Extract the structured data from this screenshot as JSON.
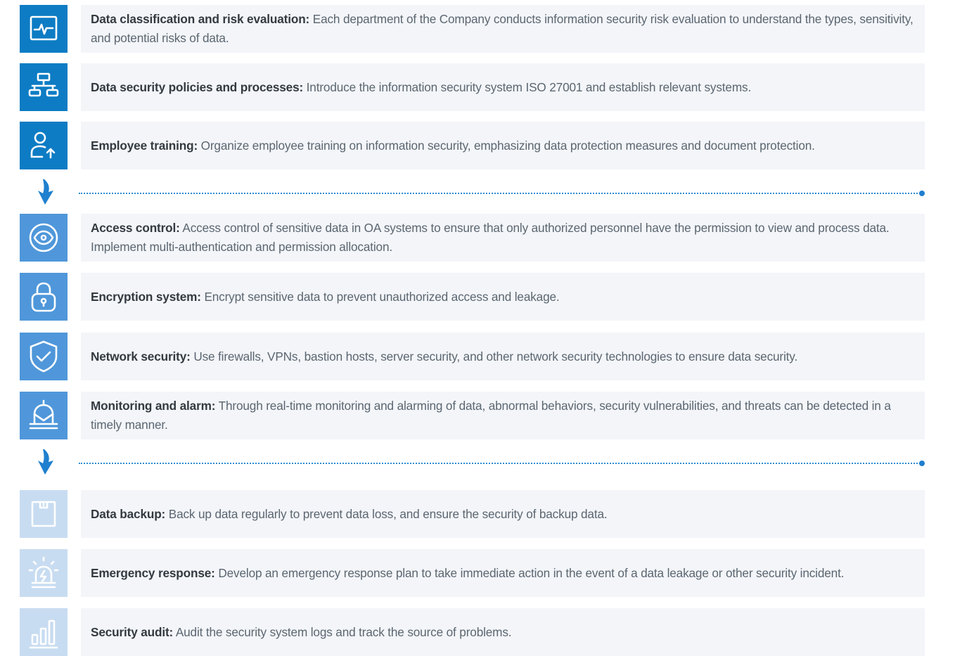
{
  "items": [
    {
      "title": "Data classification and risk evaluation:",
      "desc": " Each department of the Company conducts information security risk evaluation to understand the types, sensitivity, and potential risks of data.",
      "icon": "pulse-monitor-icon"
    },
    {
      "title": "Data security policies and processes:",
      "desc": " Introduce the information security system ISO 27001 and establish relevant systems.",
      "icon": "hierarchy-icon"
    },
    {
      "title": "Employee training:",
      "desc": " Organize employee training on information security, emphasizing data protection measures and document protection.",
      "icon": "user-upgrade-icon"
    },
    {
      "title": "Access control:",
      "desc": " Access control of sensitive data in OA systems to ensure that only authorized personnel have the permission to view and process data. Implement multi-authentication and permission allocation.",
      "icon": "eye-icon"
    },
    {
      "title": "Encryption system:",
      "desc": " Encrypt sensitive data to prevent unauthorized access and leakage.",
      "icon": "padlock-icon"
    },
    {
      "title": "Network security:",
      "desc": " Use firewalls, VPNs, bastion hosts, server security, and other network security technologies to ensure data security.",
      "icon": "shield-check-icon"
    },
    {
      "title": "Monitoring and alarm:",
      "desc": " Through real-time monitoring and alarming of data, abnormal behaviors, security vulnerabilities, and threats can be detected in a timely manner.",
      "icon": "alarm-light-icon"
    },
    {
      "title": "Data backup:",
      "desc": " Back up data regularly to prevent data loss, and ensure the security of backup data.",
      "icon": "floppy-disk-icon"
    },
    {
      "title": "Emergency response:",
      "desc": " Develop an emergency response plan to take immediate action in the event of a data leakage or other security incident.",
      "icon": "emergency-siren-icon"
    },
    {
      "title": "Security audit:",
      "desc": " Audit the security system logs and track the source of problems.",
      "icon": "bar-chart-icon"
    }
  ],
  "colors": {
    "stage1": "#0d7cc4",
    "stage2": "#4f97da",
    "stage3": "#c8dcf1",
    "card_bg": "#f3f5f9",
    "divider": "#2a8ad1"
  }
}
